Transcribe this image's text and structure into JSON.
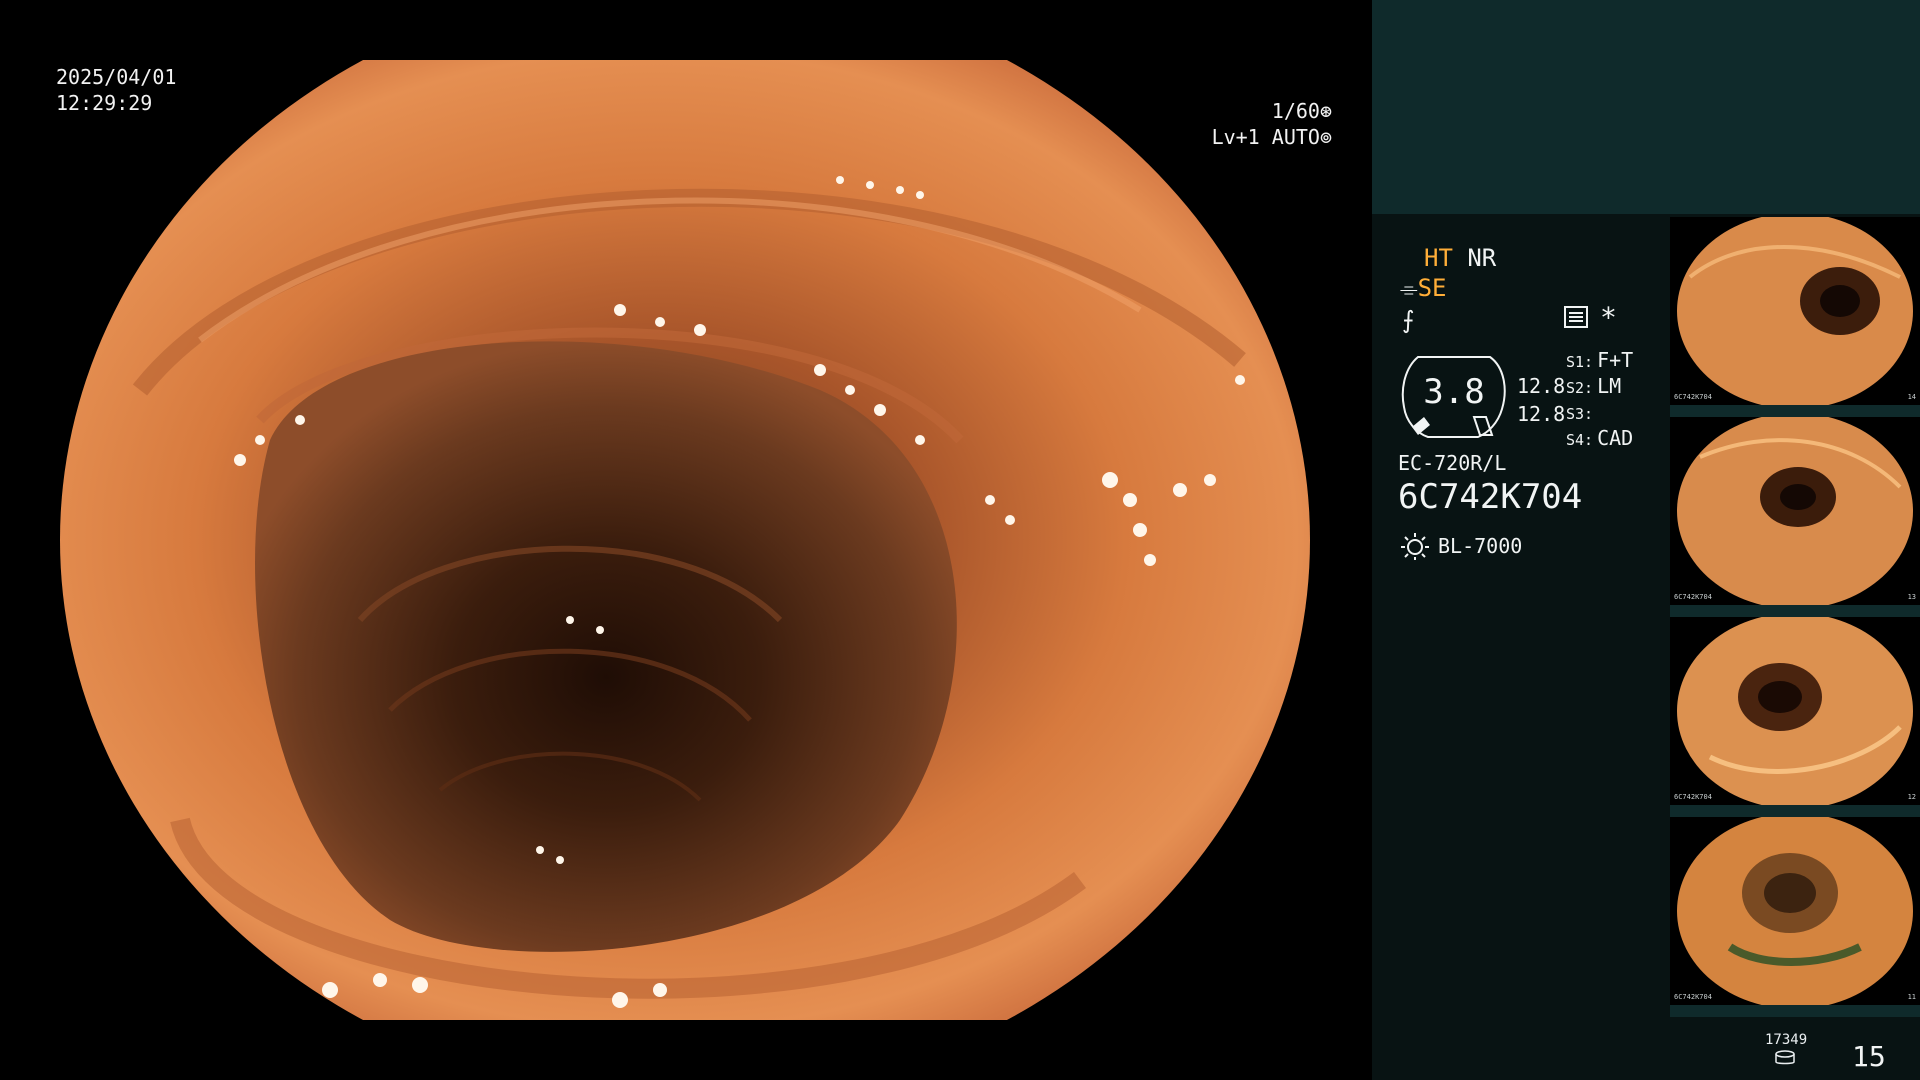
{
  "overlay": {
    "date": "2025/04/01",
    "time": "12:29:29",
    "shutter": "1/60",
    "level": "Lv+1",
    "mode": "AUTO"
  },
  "panel": {
    "ht": "HT",
    "nr": "NR",
    "se": "SE",
    "gauge_value": "3.8",
    "value_a": "12.8",
    "value_b": "12.8",
    "settings": [
      {
        "tag": "S1:",
        "value": "F+T"
      },
      {
        "tag": "S2:",
        "value": "LM"
      },
      {
        "tag": "S3:",
        "value": ""
      },
      {
        "tag": "S4:",
        "value": "CAD"
      }
    ],
    "scope_model": "EC-720R/L",
    "scope_serial": "6C742K704",
    "light_source": "BL-7000"
  },
  "thumbnails": [
    {
      "serial": "6C742K704",
      "index": "14"
    },
    {
      "serial": "6C742K704",
      "index": "13"
    },
    {
      "serial": "6C742K704",
      "index": "12"
    },
    {
      "serial": "6C742K704",
      "index": "11"
    }
  ],
  "footer": {
    "storage_count": "17349",
    "page_number": "15"
  },
  "colors": {
    "accent_amber": "#ffae38",
    "panel_dark": "#081313",
    "panel_teal": "#0f2a2b",
    "tissue": "#d9773a"
  },
  "icons": {
    "shutter": "aperture-icon",
    "mode": "iris-icon",
    "se": "se-mode-icon",
    "f": "freeze-icon",
    "hist": "histogram-icon",
    "asterisk": "asterisk-icon",
    "light": "light-source-icon",
    "disk": "storage-disk-icon"
  }
}
